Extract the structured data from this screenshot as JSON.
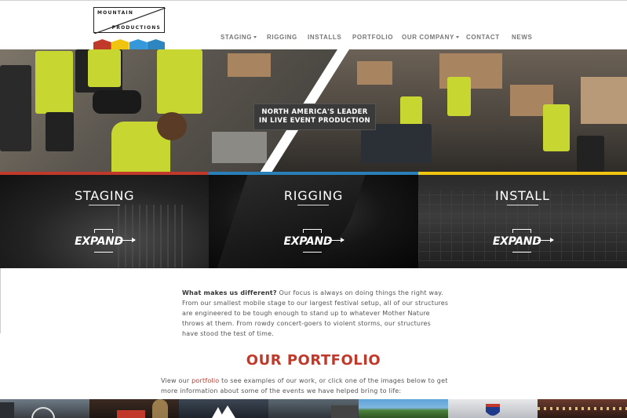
{
  "brand": {
    "logo_line1": "MOUNTAIN",
    "logo_line2": "PRODUCTIONS",
    "stripe_colors": [
      "#c0392b",
      "#f1c40f",
      "#3498db",
      "#2e86c1"
    ]
  },
  "nav": {
    "items": [
      {
        "label": "STAGING",
        "dropdown": true
      },
      {
        "label": "RIGGING",
        "dropdown": false
      },
      {
        "label": "INSTALLS",
        "dropdown": false
      },
      {
        "label": "PORTFOLIO",
        "dropdown": false
      },
      {
        "label": "OUR COMPANY",
        "dropdown": true
      },
      {
        "label": "CONTACT",
        "dropdown": false
      },
      {
        "label": "NEWS",
        "dropdown": false
      }
    ]
  },
  "hero": {
    "banner_line1": "NORTH AMERICA'S LEADER",
    "banner_line2": "IN LIVE EVENT PRODUCTION"
  },
  "accent_colors": {
    "red": "#c0392b",
    "blue": "#2980b9",
    "yellow": "#f1c40f"
  },
  "panels": [
    {
      "title": "STAGING",
      "expand_label": "EXPAND"
    },
    {
      "title": "RIGGING",
      "expand_label": "EXPAND"
    },
    {
      "title": "INSTALL",
      "expand_label": "EXPAND"
    }
  ],
  "intro": {
    "lead": "What makes us different?",
    "body": " Our focus is always on doing things the right way. From our smallest mobile stage to our largest festival setup, all of our structures are engineered to be tough enough to stand up to whatever Mother Nature throws at them. From rowdy concert-goers to violent storms, our structures have stood the test of time."
  },
  "portfolio": {
    "title": "OUR PORTFOLIO",
    "desc_before": "View our ",
    "desc_link": "portfolio",
    "desc_after": " to see examples of our work, or click one of the images below to get more information about some of the events we have helped bring to life:"
  }
}
